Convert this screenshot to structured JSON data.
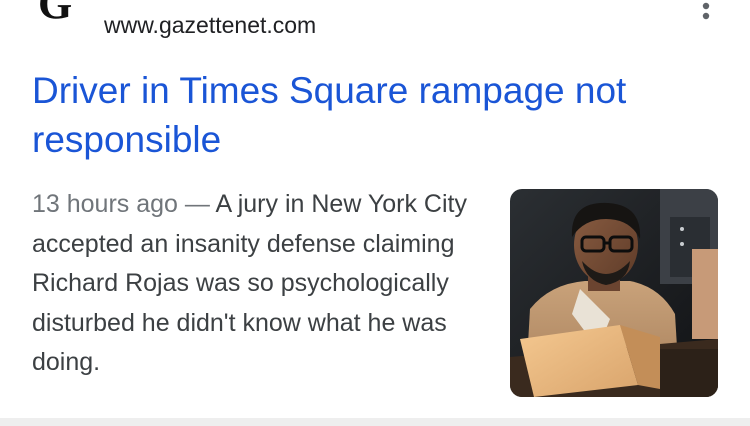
{
  "result": {
    "favicon_letter": "G",
    "source_url": "www.gazettenet.com",
    "more_icon": "more-vert-icon",
    "headline": "Driver in Times Square rampage not responsible",
    "age": "13 hours ago",
    "separator": "—",
    "snippet": "A jury in New York City accepted an insanity defense claiming Richard Rojas was so psychologically disturbed he didn't know what he was doing.",
    "thumbnail": "news-photo"
  },
  "colors": {
    "headline": "#1a55d6",
    "url": "#202124",
    "snippet": "#3c4043",
    "meta": "#70757a",
    "divider": "#eeeeee"
  }
}
